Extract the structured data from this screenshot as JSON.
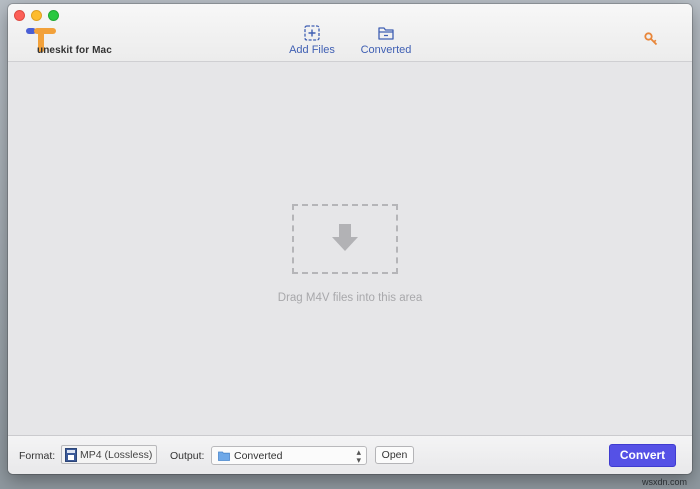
{
  "app": {
    "logo_text": "uneskit for Mac"
  },
  "toolbar": {
    "add_files_label": "Add Files",
    "converted_label": "Converted",
    "accent_color": "#3f5fb3",
    "key_color": "#e8863a"
  },
  "dropzone": {
    "hint": "Drag M4V files into this area"
  },
  "bottom": {
    "format_label": "Format:",
    "format_value": "MP4 (Lossless)",
    "output_label": "Output:",
    "output_value": "Converted",
    "open_label": "Open",
    "convert_label": "Convert",
    "convert_color": "#5551e6"
  },
  "watermark": "wsxdn.com",
  "icons": {
    "add_files": "plus-square-icon",
    "converted": "folder-icon",
    "key": "key-icon",
    "drop_arrow": "arrow-down-icon",
    "format": "mp4-file-icon",
    "output_folder": "folder-icon"
  }
}
